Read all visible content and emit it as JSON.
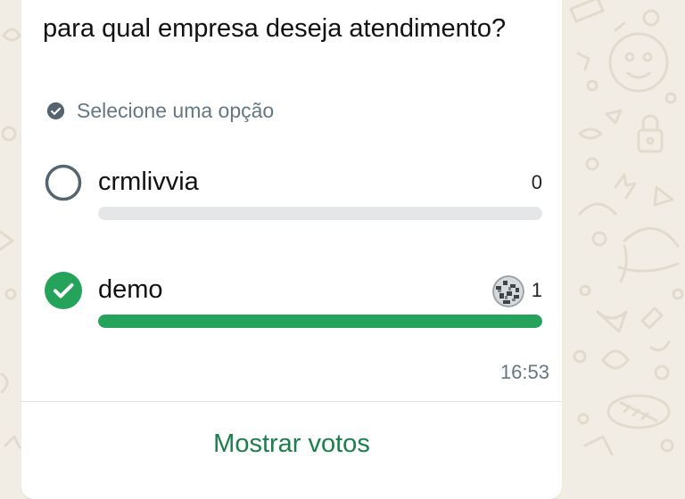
{
  "poll": {
    "question": "para qual empresa deseja atendimento?",
    "hint": "Selecione uma opção",
    "options": [
      {
        "label": "crmlivvia",
        "votes": "0",
        "selected": false,
        "fill_fraction": 0
      },
      {
        "label": "demo",
        "votes": "1",
        "selected": true,
        "fill_fraction": 1
      }
    ],
    "time": "16:53",
    "show_votes_label": "Mostrar votos"
  },
  "colors": {
    "accent": "#25a35a",
    "link": "#1b7f4b",
    "track": "#e4e6e8",
    "wallpaper": "#f2ede4",
    "muted_text": "#667781"
  },
  "icons": {
    "hint": "check-circle-icon",
    "unselected": "radio-empty-icon",
    "selected": "check-circle-filled-icon",
    "voter": "avatar"
  }
}
